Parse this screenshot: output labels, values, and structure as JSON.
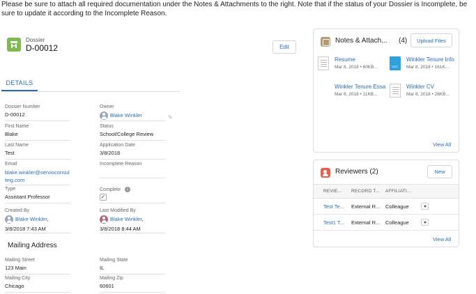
{
  "notice": "Please be sure to attach all required documentation under the  Notes & Attachments to the right. Note that if the status of your Dossier is Incomplete, be sure to update it according to the Incomplete Reason.",
  "record": {
    "type_label": "Dossier",
    "title": "D-00012",
    "edit_label": "Edit",
    "icon": "dossier-icon"
  },
  "tabs": {
    "details": "DETAILS"
  },
  "fields": {
    "dossier_number": {
      "label": "Dossier Number",
      "value": "D-00012"
    },
    "owner": {
      "label": "Owner",
      "value": "Blake Winkler"
    },
    "first_name": {
      "label": "First Name",
      "value": "Blake"
    },
    "status": {
      "label": "Status",
      "value": "School/College Review"
    },
    "last_name": {
      "label": "Last Name",
      "value": "Test"
    },
    "application_date": {
      "label": "Application Date",
      "value": "3/8/2018"
    },
    "email": {
      "label": "Email",
      "value": "blake.winkler@servioconsulting.com",
      "line1": "blake.winkler@servioconsul",
      "line2": "ting.com"
    },
    "incomplete_reason": {
      "label": "Incomplete Reason",
      "value": ""
    },
    "type": {
      "label": "Type",
      "value": "Assistant Professor"
    },
    "complete": {
      "label": "Complete",
      "checked": true
    },
    "created_by": {
      "label": "Created By",
      "name": "Blake Winkler",
      "suffix": ",",
      "date": "3/8/2018 7:43 AM"
    },
    "last_modified_by": {
      "label": "Last Modified By",
      "name": "Blake Winkler",
      "suffix": ",",
      "date": "3/8/2018 8:44 AM"
    }
  },
  "mailing": {
    "title": "Mailing Address",
    "street": {
      "label": "Mailing Street",
      "value": "123 Main"
    },
    "state": {
      "label": "Mailing State",
      "value": "IL"
    },
    "city": {
      "label": "Mailing City",
      "value": "Chicago"
    },
    "zip": {
      "label": "Mailing Zip",
      "value": "60601"
    }
  },
  "notes": {
    "title": "Notes & Attach...",
    "count": "(4)",
    "upload_label": "Upload Files",
    "view_all": "View All",
    "files": [
      {
        "name": "Resume",
        "meta": "Mar 8, 2018 • 60KB...",
        "thumb": "text-document"
      },
      {
        "name": "Winkler Tenure Info",
        "meta": "Mar 8, 2018 • 161K...",
        "thumb": "doc-file",
        "thumb_label": "DOC"
      },
      {
        "name": "Winkler Tenure Essa",
        "meta": "Mar 8, 2018 • 11KB...",
        "thumb": "blank"
      },
      {
        "name": "Winkler CV",
        "meta": "Mar 8, 2018 • 28KB...",
        "thumb": "text-document"
      }
    ]
  },
  "reviewers": {
    "title": "Reviewers (2)",
    "new_label": "New",
    "view_all": "View All",
    "columns": [
      "REVIE...",
      "RECORD T...",
      "AFFILIATI..."
    ],
    "rows": [
      {
        "reviewer": "Test Te...",
        "record_type": "External R...",
        "affiliation": "Colleague"
      },
      {
        "reviewer": "Test1 T...",
        "record_type": "External R...",
        "affiliation": "Colleague"
      }
    ]
  }
}
